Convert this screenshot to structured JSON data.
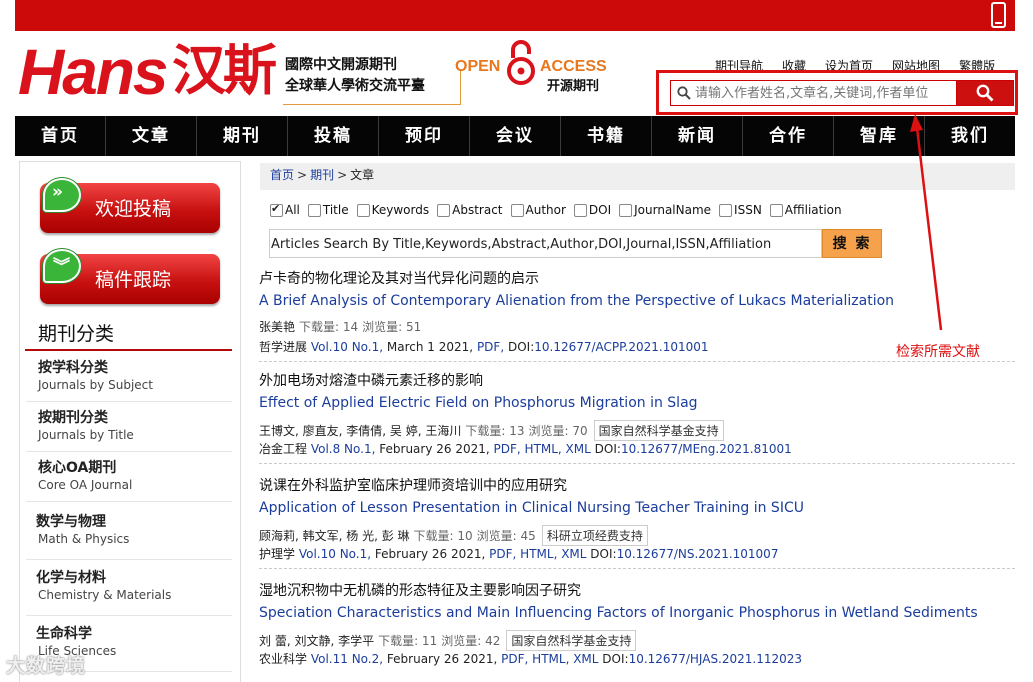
{
  "brand": {
    "logo_latin": "Hans",
    "logo_cn": "汉斯",
    "slogan_line1": "國際中文開源期刊",
    "slogan_line2": "全球華人學術交流平臺",
    "oa_open": "OPEN",
    "oa_access": "ACCESS",
    "oa_sub": "开源期刊"
  },
  "top_links": [
    "期刊导航",
    "收藏",
    "设为首页",
    "网站地图",
    "繁體版"
  ],
  "header_search": {
    "placeholder": "请输入作者姓名,文章名,关键词,作者单位"
  },
  "nav": [
    "首页",
    "文章",
    "期刊",
    "投稿",
    "预印",
    "会议",
    "书籍",
    "新闻",
    "合作",
    "智库",
    "我们"
  ],
  "sidebar": {
    "submit_button": "欢迎投稿",
    "track_button": "稿件跟踪",
    "section_title": "期刊分类",
    "categories": [
      {
        "cn": "按学科分类",
        "en": "Journals by Subject"
      },
      {
        "cn": "按期刊分类",
        "en": "Journals by Title"
      },
      {
        "cn": "核心OA期刊",
        "en": "Core OA Journal"
      },
      {
        "cn": "数学与物理",
        "en": "Math & Physics"
      },
      {
        "cn": "化学与材料",
        "en": "Chemistry & Materials"
      },
      {
        "cn": "生命科学",
        "en": "Life Sciences"
      }
    ]
  },
  "breadcrumb": {
    "home": "首页",
    "sep1": ">",
    "journals": "期刊",
    "sep2": ">",
    "current": "文章"
  },
  "filters": [
    {
      "label": "All",
      "checked": true
    },
    {
      "label": "Title",
      "checked": false
    },
    {
      "label": "Keywords",
      "checked": false
    },
    {
      "label": "Abstract",
      "checked": false
    },
    {
      "label": "Author",
      "checked": false
    },
    {
      "label": "DOI",
      "checked": false
    },
    {
      "label": "JournalName",
      "checked": false
    },
    {
      "label": "ISSN",
      "checked": false
    },
    {
      "label": "Affiliation",
      "checked": false
    }
  ],
  "main_search": {
    "value": "Articles Search By Title,Keywords,Abstract,Author,DOI,Journal,ISSN,Affiliation",
    "button": "搜 索"
  },
  "articles": [
    {
      "title_cn": "卢卡奇的物化理论及其对当代异化问题的启示",
      "title_en": "A Brief Analysis of Contemporary Alienation from the Perspective of Lukacs Materialization",
      "authors": "张美艳",
      "downloads": "下载量: 14",
      "views": "浏览量: 51",
      "fund": "",
      "journal": "哲学进展",
      "volume": "Vol.10 No.1,",
      "date": "March 1 2021,",
      "formats": "PDF,",
      "doi_label": "DOI:",
      "doi": "10.12677/ACPP.2021.101001"
    },
    {
      "title_cn": "外加电场对熔渣中磷元素迁移的影响",
      "title_en": "Effect of Applied Electric Field on Phosphorus Migration in Slag",
      "authors": "王博文, 廖直友, 李倩倩, 吴 婷, 王海川",
      "downloads": "下载量: 13",
      "views": "浏览量: 70",
      "fund": "国家自然科学基金支持",
      "journal": "冶金工程",
      "volume": "Vol.8 No.1,",
      "date": "February 26 2021,",
      "formats": "PDF, HTML, XML",
      "doi_label": "DOI:",
      "doi": "10.12677/MEng.2021.81001"
    },
    {
      "title_cn": "说课在外科监护室临床护理师资培训中的应用研究",
      "title_en": "Application of Lesson Presentation in Clinical Nursing Teacher Training in SICU",
      "authors": "顾海莉, 韩文军, 杨 光, 彭 琳",
      "downloads": "下载量: 10",
      "views": "浏览量: 45",
      "fund": "科研立项经费支持",
      "journal": "护理学",
      "volume": "Vol.10 No.1,",
      "date": "February 26 2021,",
      "formats": "PDF, HTML, XML",
      "doi_label": "DOI:",
      "doi": "10.12677/NS.2021.101007"
    },
    {
      "title_cn": "湿地沉积物中无机磷的形态特征及主要影响因子研究",
      "title_en": "Speciation Characteristics and Main Influencing Factors of Inorganic Phosphorus in Wetland Sediments",
      "authors": "刘 蕾, 刘文静, 李学平",
      "downloads": "下载量: 11",
      "views": "浏览量: 42",
      "fund": "国家自然科学基金支持",
      "journal": "农业科学",
      "volume": "Vol.11 No.2,",
      "date": "February 26 2021,",
      "formats": "PDF, HTML, XML",
      "doi_label": "DOI:",
      "doi": "10.12677/HJAS.2021.112023"
    }
  ],
  "annotation": "检索所需文献",
  "watermark": "大数跨境",
  "colors": {
    "brand_red": "#cc0a0a",
    "nav_bg": "#050505",
    "link_blue": "#1b3d9c",
    "search_orange": "#f6a24d"
  },
  "icons": {
    "search": "search-icon",
    "phone": "phone-icon",
    "lock": "open-access-lock-icon"
  }
}
